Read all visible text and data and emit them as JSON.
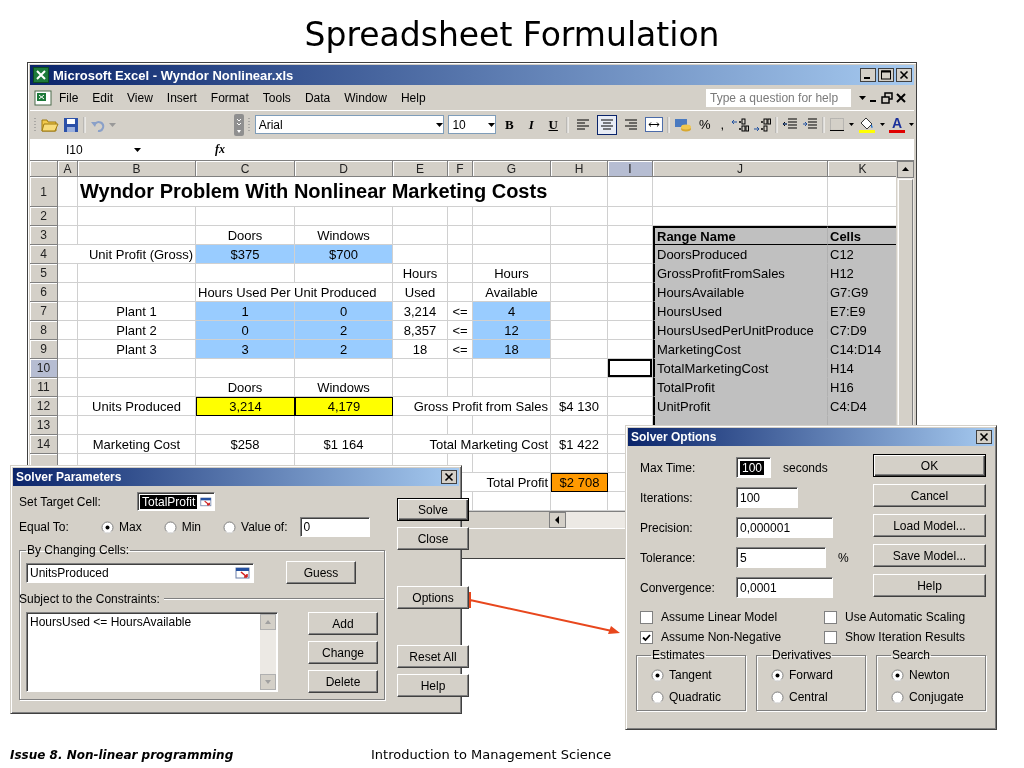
{
  "slide": {
    "title": "Spreadsheet Formulation",
    "footer_left": "Issue 8. Non-linear programming",
    "footer_center": "Introduction to Management Science"
  },
  "excel": {
    "title": "Microsoft Excel - Wyndor Nonlinear.xls",
    "menu": [
      "File",
      "Edit",
      "View",
      "Insert",
      "Format",
      "Tools",
      "Data",
      "Window",
      "Help"
    ],
    "help_placeholder": "Type a question for help",
    "toolbar": {
      "font": "Arial",
      "size": "10",
      "bold": "B",
      "italic": "I",
      "underline": "U",
      "percent": "%",
      "comma": ",",
      "font_color": "A",
      "alignment": [
        {
          "kind": "left",
          "selected": false
        },
        {
          "kind": "center",
          "selected": true
        },
        {
          "kind": "right",
          "selected": false
        }
      ]
    },
    "name_box": "I10",
    "formula_label": "fx",
    "columns": [
      {
        "label": "A",
        "selected": false
      },
      {
        "label": "B",
        "selected": false
      },
      {
        "label": "C",
        "selected": false
      },
      {
        "label": "D",
        "selected": false
      },
      {
        "label": "E",
        "selected": false
      },
      {
        "label": "F",
        "selected": false
      },
      {
        "label": "G",
        "selected": false
      },
      {
        "label": "H",
        "selected": false
      },
      {
        "label": "I",
        "selected": true
      },
      {
        "label": "J",
        "selected": false
      },
      {
        "label": "K",
        "selected": false
      }
    ],
    "rows": [
      {
        "label": "1",
        "selected": false,
        "cells": [
          {
            "kind": "empty"
          },
          {
            "kind": "title",
            "text": "Wyndor Problem With Nonlinear Marketing Costs"
          },
          {
            "kind": "empty"
          },
          {
            "kind": "empty"
          },
          {
            "kind": "empty"
          },
          {
            "kind": "empty"
          },
          {
            "kind": "empty"
          },
          {
            "kind": "empty"
          },
          {
            "kind": "empty"
          },
          {
            "kind": "empty"
          },
          {
            "kind": "empty"
          }
        ]
      },
      {
        "label": "2",
        "selected": false,
        "cells": [
          {
            "kind": "empty"
          },
          {
            "kind": "empty"
          },
          {
            "kind": "empty"
          },
          {
            "kind": "empty"
          },
          {
            "kind": "empty"
          },
          {
            "kind": "empty"
          },
          {
            "kind": "empty"
          },
          {
            "kind": "empty"
          },
          {
            "kind": "empty"
          },
          {
            "kind": "empty"
          },
          {
            "kind": "empty"
          }
        ]
      },
      {
        "label": "3",
        "selected": false,
        "cells": [
          {
            "kind": "empty"
          },
          {
            "kind": "empty"
          },
          {
            "kind": "center",
            "text": "Doors"
          },
          {
            "kind": "center",
            "text": "Windows"
          },
          {
            "kind": "empty"
          },
          {
            "kind": "empty"
          },
          {
            "kind": "empty"
          },
          {
            "kind": "empty"
          },
          {
            "kind": "empty"
          },
          {
            "kind": "range_head",
            "text": "Range Name"
          },
          {
            "kind": "range_head",
            "text": "Cells"
          }
        ]
      },
      {
        "label": "4",
        "selected": false,
        "cells": [
          {
            "kind": "empty"
          },
          {
            "kind": "right",
            "text": "Unit Profit (Gross)"
          },
          {
            "kind": "input",
            "text": "$375"
          },
          {
            "kind": "input",
            "text": "$700"
          },
          {
            "kind": "empty"
          },
          {
            "kind": "empty"
          },
          {
            "kind": "empty"
          },
          {
            "kind": "empty"
          },
          {
            "kind": "empty"
          },
          {
            "kind": "range",
            "text": "DoorsProduced"
          },
          {
            "kind": "range",
            "text": "C12"
          }
        ]
      },
      {
        "label": "5",
        "selected": false,
        "cells": [
          {
            "kind": "empty"
          },
          {
            "kind": "empty"
          },
          {
            "kind": "empty"
          },
          {
            "kind": "empty"
          },
          {
            "kind": "center",
            "text": "Hours"
          },
          {
            "kind": "empty"
          },
          {
            "kind": "center",
            "text": "Hours"
          },
          {
            "kind": "empty"
          },
          {
            "kind": "empty"
          },
          {
            "kind": "range",
            "text": "GrossProfitFromSales"
          },
          {
            "kind": "range",
            "text": "H12"
          }
        ]
      },
      {
        "label": "6",
        "selected": false,
        "cells": [
          {
            "kind": "empty"
          },
          {
            "kind": "empty"
          },
          {
            "kind": "text",
            "text": "Hours Used Per Unit Produced"
          },
          {
            "kind": "empty"
          },
          {
            "kind": "center",
            "text": "Used"
          },
          {
            "kind": "empty"
          },
          {
            "kind": "center",
            "text": "Available"
          },
          {
            "kind": "empty"
          },
          {
            "kind": "empty"
          },
          {
            "kind": "range",
            "text": "HoursAvailable"
          },
          {
            "kind": "range",
            "text": "G7:G9"
          }
        ]
      },
      {
        "label": "7",
        "selected": false,
        "cells": [
          {
            "kind": "empty"
          },
          {
            "kind": "center",
            "text": "Plant 1"
          },
          {
            "kind": "input",
            "text": "1"
          },
          {
            "kind": "input",
            "text": "0"
          },
          {
            "kind": "center",
            "text": "3,214"
          },
          {
            "kind": "center",
            "text": "<="
          },
          {
            "kind": "input",
            "text": "4"
          },
          {
            "kind": "empty"
          },
          {
            "kind": "empty"
          },
          {
            "kind": "range",
            "text": "HoursUsed"
          },
          {
            "kind": "range",
            "text": "E7:E9"
          }
        ]
      },
      {
        "label": "8",
        "selected": false,
        "cells": [
          {
            "kind": "empty"
          },
          {
            "kind": "center",
            "text": "Plant 2"
          },
          {
            "kind": "input",
            "text": "0"
          },
          {
            "kind": "input",
            "text": "2"
          },
          {
            "kind": "center",
            "text": "8,357"
          },
          {
            "kind": "center",
            "text": "<="
          },
          {
            "kind": "input",
            "text": "12"
          },
          {
            "kind": "empty"
          },
          {
            "kind": "empty"
          },
          {
            "kind": "range",
            "text": "HoursUsedPerUnitProduce"
          },
          {
            "kind": "range",
            "text": "C7:D9"
          }
        ]
      },
      {
        "label": "9",
        "selected": false,
        "cells": [
          {
            "kind": "empty"
          },
          {
            "kind": "center",
            "text": "Plant 3"
          },
          {
            "kind": "input",
            "text": "3"
          },
          {
            "kind": "input",
            "text": "2"
          },
          {
            "kind": "center",
            "text": "18"
          },
          {
            "kind": "center",
            "text": "<="
          },
          {
            "kind": "input",
            "text": "18"
          },
          {
            "kind": "empty"
          },
          {
            "kind": "empty"
          },
          {
            "kind": "range",
            "text": "MarketingCost"
          },
          {
            "kind": "range",
            "text": "C14:D14"
          }
        ]
      },
      {
        "label": "10",
        "selected": true,
        "cells": [
          {
            "kind": "empty"
          },
          {
            "kind": "empty"
          },
          {
            "kind": "empty"
          },
          {
            "kind": "empty"
          },
          {
            "kind": "empty"
          },
          {
            "kind": "empty"
          },
          {
            "kind": "empty"
          },
          {
            "kind": "empty"
          },
          {
            "kind": "empty"
          },
          {
            "kind": "range",
            "text": "TotalMarketingCost"
          },
          {
            "kind": "range",
            "text": "H14"
          }
        ]
      },
      {
        "label": "11",
        "selected": false,
        "cells": [
          {
            "kind": "empty"
          },
          {
            "kind": "empty"
          },
          {
            "kind": "center",
            "text": "Doors"
          },
          {
            "kind": "center",
            "text": "Windows"
          },
          {
            "kind": "empty"
          },
          {
            "kind": "empty"
          },
          {
            "kind": "empty"
          },
          {
            "kind": "empty"
          },
          {
            "kind": "empty"
          },
          {
            "kind": "range",
            "text": "TotalProfit"
          },
          {
            "kind": "range",
            "text": "H16"
          }
        ]
      },
      {
        "label": "12",
        "selected": false,
        "cells": [
          {
            "kind": "empty"
          },
          {
            "kind": "center",
            "text": "Units Produced"
          },
          {
            "kind": "changing",
            "text": "3,214"
          },
          {
            "kind": "changing",
            "text": "4,179"
          },
          {
            "kind": "empty"
          },
          {
            "kind": "empty"
          },
          {
            "kind": "right",
            "text": "Gross Profit from Sales"
          },
          {
            "kind": "center",
            "text": "$4 130"
          },
          {
            "kind": "empty"
          },
          {
            "kind": "range",
            "text": "UnitProfit"
          },
          {
            "kind": "range",
            "text": "C4:D4"
          }
        ]
      },
      {
        "label": "13",
        "selected": false,
        "cells": [
          {
            "kind": "empty"
          },
          {
            "kind": "empty"
          },
          {
            "kind": "empty"
          },
          {
            "kind": "empty"
          },
          {
            "kind": "empty"
          },
          {
            "kind": "empty"
          },
          {
            "kind": "empty"
          },
          {
            "kind": "empty"
          },
          {
            "kind": "empty"
          },
          {
            "kind": "range"
          },
          {
            "kind": "range"
          }
        ]
      },
      {
        "label": "14",
        "selected": false,
        "cells": [
          {
            "kind": "empty"
          },
          {
            "kind": "center",
            "text": "Marketing Cost"
          },
          {
            "kind": "center",
            "text": "$258"
          },
          {
            "kind": "center",
            "text": "$1 164"
          },
          {
            "kind": "empty"
          },
          {
            "kind": "empty"
          },
          {
            "kind": "right",
            "text": "Total Marketing Cost"
          },
          {
            "kind": "center",
            "text": "$1 422"
          },
          {
            "kind": "empty"
          },
          {
            "kind": "covered"
          },
          {
            "kind": "covered"
          }
        ]
      },
      {
        "selected": false,
        "cells": [
          {
            "kind": "empty"
          },
          {
            "kind": "empty"
          },
          {
            "kind": "empty"
          },
          {
            "kind": "empty"
          },
          {
            "kind": "empty"
          },
          {
            "kind": "empty"
          },
          {
            "kind": "empty"
          },
          {
            "kind": "empty"
          },
          {
            "kind": "empty"
          },
          {
            "kind": "covered"
          },
          {
            "kind": "covered"
          }
        ]
      },
      {
        "cells": [
          {
            "kind": "empty"
          },
          {
            "kind": "empty"
          },
          {
            "kind": "empty"
          },
          {
            "kind": "empty"
          },
          {
            "kind": "empty"
          },
          {
            "kind": "empty"
          },
          {
            "kind": "right",
            "text": "Total Profit"
          },
          {
            "kind": "target",
            "text": "$2 708"
          },
          {
            "kind": "empty"
          },
          {
            "kind": "empty"
          },
          {
            "kind": "empty"
          }
        ]
      }
    ]
  },
  "solver_parameters": {
    "title": "Solver Parameters",
    "target_label": "Set Target Cell:",
    "target": {
      "value": "TotalProfit",
      "selected": true
    },
    "equal_label": "Equal To:",
    "equal_options": [
      {
        "label": "Max",
        "selected": true
      },
      {
        "label": "Min",
        "selected": false
      },
      {
        "label": "Value of:",
        "selected": false
      }
    ],
    "value_of": "0",
    "changing_label": "By Changing Cells:",
    "changing": "UnitsProduced",
    "guess_button": "Guess",
    "constraints_label": "Subject to the Constraints:",
    "constraints": [
      "HoursUsed <= HoursAvailable"
    ],
    "constraint_buttons": [
      "Add",
      "Change",
      "Delete"
    ],
    "buttons": [
      [
        {
          "label": "Solve",
          "default": true
        },
        {
          "label": "Close",
          "default": false
        }
      ],
      [
        {
          "label": "Options",
          "default": false
        }
      ],
      [
        {
          "label": "Reset All",
          "default": false
        },
        {
          "label": "Help",
          "default": false
        }
      ]
    ]
  },
  "solver_options": {
    "title": "Solver Options",
    "fields": [
      {
        "label": "Max Time:",
        "value": "100",
        "selected": true,
        "unit": "seconds",
        "kind": "tiny"
      },
      {
        "label": "Iterations:",
        "value": "100",
        "selected": false,
        "kind": "short"
      },
      {
        "label": "Precision:",
        "value": "0,000001",
        "selected": false,
        "kind": "long"
      },
      {
        "label": "Tolerance:",
        "value": "5",
        "selected": false,
        "unit": "%",
        "kind": "medium"
      },
      {
        "label": "Convergence:",
        "value": "0,0001",
        "selected": false,
        "kind": "long"
      }
    ],
    "buttons": [
      {
        "label": "OK",
        "default": true
      },
      {
        "label": "Cancel",
        "default": false
      },
      {
        "label": "Load Model...",
        "default": false
      },
      {
        "label": "Save Model...",
        "default": false
      },
      {
        "label": "Help",
        "default": false
      }
    ],
    "checkboxes": [
      {
        "label": "Assume Linear Model",
        "checked": false
      },
      {
        "label": "Use Automatic Scaling",
        "checked": false
      },
      {
        "label": "Assume Non-Negative",
        "checked": true
      },
      {
        "label": "Show Iteration Results",
        "checked": false
      }
    ],
    "groups": [
      {
        "title": "Estimates",
        "options": [
          {
            "label": "Tangent",
            "selected": true
          },
          {
            "label": "Quadratic",
            "selected": false
          }
        ]
      },
      {
        "title": "Derivatives",
        "options": [
          {
            "label": "Forward",
            "selected": true
          },
          {
            "label": "Central",
            "selected": false
          }
        ]
      },
      {
        "title": "Search",
        "options": [
          {
            "label": "Newton",
            "selected": true
          },
          {
            "label": "Conjugate",
            "selected": false
          }
        ]
      }
    ]
  }
}
